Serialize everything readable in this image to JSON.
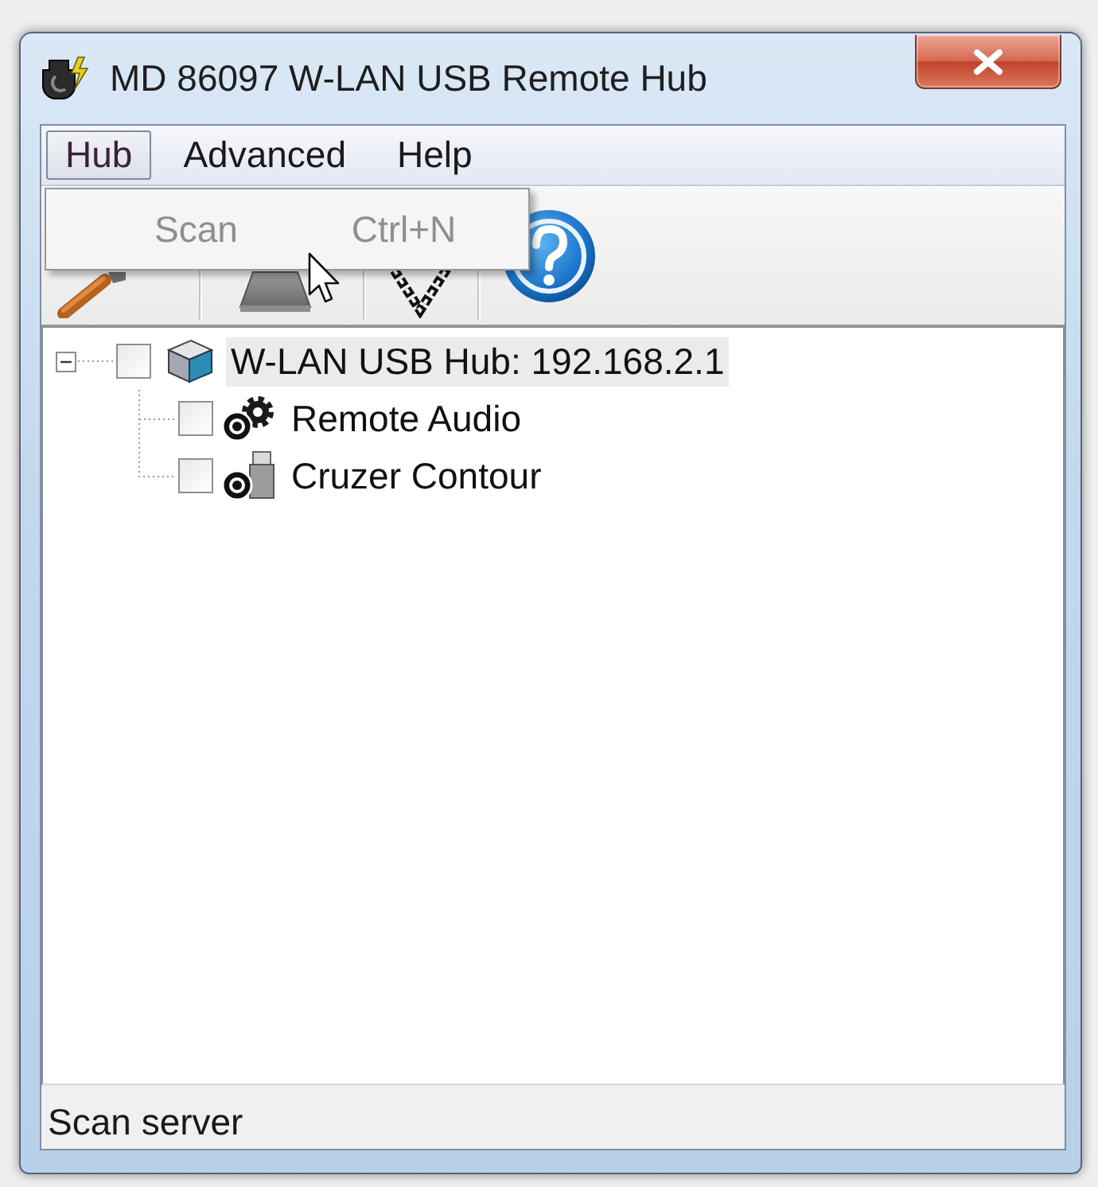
{
  "window": {
    "title": "MD 86097 W-LAN USB Remote Hub"
  },
  "menu_bar": {
    "items": [
      {
        "label": "Hub",
        "selected": true
      },
      {
        "label": "Advanced",
        "selected": false
      },
      {
        "label": "Help",
        "selected": false
      }
    ]
  },
  "menu_dropdown": {
    "items": [
      {
        "label": "Scan",
        "shortcut": "Ctrl+N",
        "disabled": true
      }
    ]
  },
  "tree": {
    "nodes": [
      {
        "label": "W-LAN USB Hub: 192.168.2.1",
        "checked": false,
        "expanded": true,
        "selected": true,
        "children": [
          {
            "label": "Remote Audio",
            "checked": false,
            "selected": false
          },
          {
            "label": "Cruzer Contour",
            "checked": false,
            "selected": false
          }
        ]
      }
    ]
  },
  "status_bar": {
    "text": "Scan server"
  }
}
